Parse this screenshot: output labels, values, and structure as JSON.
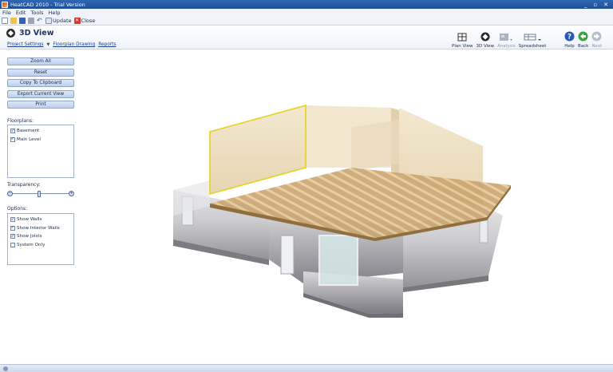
{
  "window": {
    "title": "HeatCAD 2010 - Trial Version",
    "controls": [
      "_",
      "▫",
      "✕"
    ]
  },
  "menu": [
    "File",
    "Edit",
    "Tools",
    "Help"
  ],
  "toolbar": {
    "update_label": "Update",
    "close_label": "Close"
  },
  "header": {
    "title": "3D View",
    "links": {
      "project_settings": "Project Settings",
      "arrow": "▼",
      "floorplan_drawing": "Floorplan Drawing",
      "reports": "Reports"
    },
    "tools": {
      "plan_view": "Plan View",
      "three_d_view": "3D View",
      "analysis": "Analysis",
      "spreadsheet": "Spreadsheet",
      "help": "Help",
      "back": "Back",
      "next": "Next"
    }
  },
  "left_panel": {
    "buttons": [
      "Zoom All",
      "Reset",
      "Copy To Clipboard",
      "Export Current View",
      "Print"
    ],
    "floorplans_label": "Floorplans:",
    "floorplans": [
      {
        "label": "Basement",
        "checked": true
      },
      {
        "label": "Main Level",
        "checked": true
      }
    ],
    "transparency_label": "Transparency:",
    "transparency": 0.5,
    "options_label": "Options:",
    "options": [
      {
        "label": "Show Walls",
        "checked": true
      },
      {
        "label": "Show Interior Walls",
        "checked": true
      },
      {
        "label": "Show Joists",
        "checked": true
      },
      {
        "label": "System Only",
        "checked": false
      }
    ]
  },
  "colors": {
    "selection_outline": "#e6d21c",
    "wall_tint": "#e8d5ae",
    "joist": "#c99d62",
    "foundation": "#8f8f96",
    "accent_blue": "#2e66b2"
  }
}
